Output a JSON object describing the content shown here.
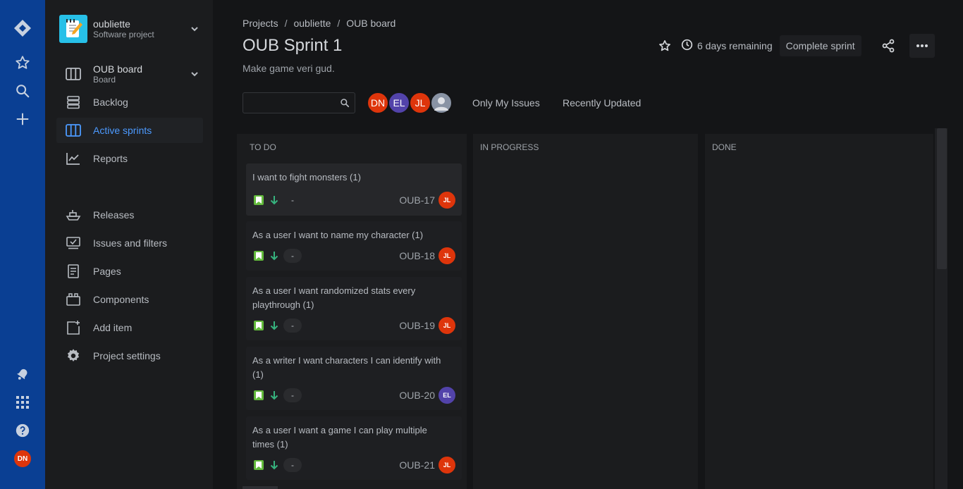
{
  "global_nav": {
    "icons": [
      "jira-logo-icon",
      "star-icon",
      "search-icon",
      "plus-icon",
      "notifications-icon",
      "app-switcher-icon",
      "help-icon"
    ],
    "user_initials": "DN"
  },
  "project": {
    "name": "oubliette",
    "type": "Software project"
  },
  "board_switcher": {
    "name": "OUB board",
    "type": "Board"
  },
  "sidebar": {
    "items": [
      {
        "label": "Backlog",
        "icon": "backlog-icon",
        "active": false
      },
      {
        "label": "Active sprints",
        "icon": "board-icon",
        "active": true
      },
      {
        "label": "Reports",
        "icon": "chart-icon",
        "active": false
      },
      {
        "label": "Releases",
        "icon": "ship-icon",
        "active": false
      },
      {
        "label": "Issues and filters",
        "icon": "issues-icon",
        "active": false
      },
      {
        "label": "Pages",
        "icon": "page-icon",
        "active": false
      },
      {
        "label": "Components",
        "icon": "component-icon",
        "active": false
      },
      {
        "label": "Add item",
        "icon": "add-item-icon",
        "active": false
      },
      {
        "label": "Project settings",
        "icon": "gear-icon",
        "active": false
      }
    ]
  },
  "breadcrumbs": [
    "Projects",
    "oubliette",
    "OUB board"
  ],
  "sprint": {
    "title": "OUB Sprint 1",
    "goal": "Make game veri gud.",
    "remaining": "6 days remaining",
    "complete_label": "Complete sprint"
  },
  "search": {
    "placeholder": "",
    "value": ""
  },
  "people": [
    {
      "initials": "DN",
      "color": "#de350b"
    },
    {
      "initials": "EL",
      "color": "#5243aa"
    },
    {
      "initials": "JL",
      "color": "#de350b"
    },
    {
      "initials": "",
      "color": "#8993a4"
    }
  ],
  "quick_filters": [
    "Only My Issues",
    "Recently Updated"
  ],
  "columns": [
    {
      "title": "TO DO"
    },
    {
      "title": "IN PROGRESS"
    },
    {
      "title": "DONE"
    }
  ],
  "cards": [
    {
      "summary": "I want to fight monsters (1)",
      "estimate": "-",
      "key": "OUB-17",
      "assignee": "JL",
      "assignee_color": "#de350b"
    },
    {
      "summary": "As a user I want to name my character (1)",
      "estimate": "-",
      "key": "OUB-18",
      "assignee": "JL",
      "assignee_color": "#de350b"
    },
    {
      "summary": "As a user I want randomized stats every playthrough (1)",
      "estimate": "-",
      "key": "OUB-19",
      "assignee": "JL",
      "assignee_color": "#de350b"
    },
    {
      "summary": "As a writer I want characters I can identify with (1)",
      "estimate": "-",
      "key": "OUB-20",
      "assignee": "EL",
      "assignee_color": "#5243aa"
    },
    {
      "summary": "As a user I want a game I can play multiple times (1)",
      "estimate": "-",
      "key": "OUB-21",
      "assignee": "JL",
      "assignee_color": "#de350b"
    }
  ],
  "colors": {
    "global_nav_bg": "#0a3f93",
    "accent": "#4c9aff",
    "story_green": "#63ba3c",
    "priority_low": "#36b37e"
  }
}
